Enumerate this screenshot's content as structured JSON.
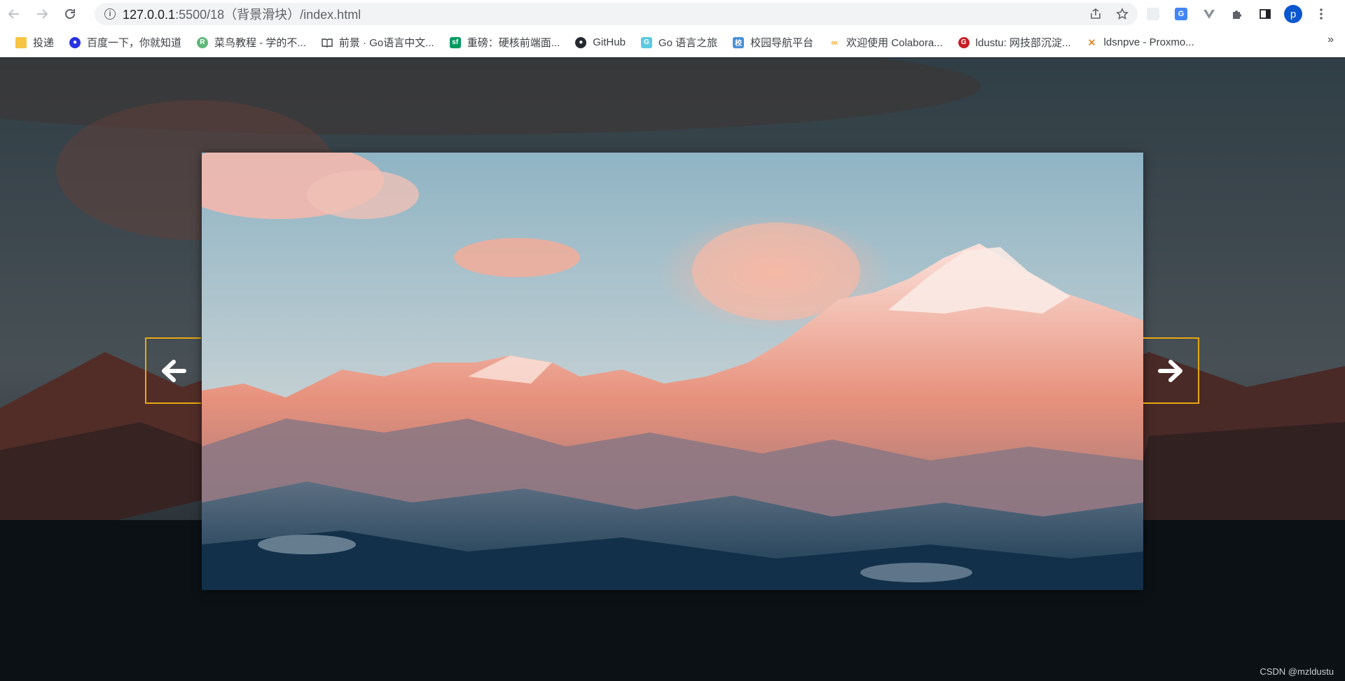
{
  "browser": {
    "url_host": "127.0.0.1",
    "url_path": ":5500/18（背景滑块）/index.html",
    "profile_initial": "p",
    "bookmarks": [
      {
        "label": "投递",
        "icon": "folder-icon",
        "color": "#f6c544"
      },
      {
        "label": "百度一下，你就知道",
        "icon": "baidu-icon",
        "color": "#2932e1"
      },
      {
        "label": "菜鸟教程 - 学的不...",
        "icon": "runoob-icon",
        "color": "#5fb878"
      },
      {
        "label": "前景 · Go语言中文...",
        "icon": "book-icon",
        "color": "#5f6368"
      },
      {
        "label": "重磅：硬核前端面...",
        "icon": "sf-icon",
        "color": "#009a61"
      },
      {
        "label": "GitHub",
        "icon": "github-icon",
        "color": "#24292f"
      },
      {
        "label": "Go 语言之旅",
        "icon": "gopher-icon",
        "color": "#5dc9e2"
      },
      {
        "label": "校园导航平台",
        "icon": "campus-icon",
        "color": "#4a90d9"
      },
      {
        "label": "欢迎使用 Colabora...",
        "icon": "colab-icon",
        "color": "#f9a825"
      },
      {
        "label": "ldustu: 网技部沉淀...",
        "icon": "gitee-icon",
        "color": "#c71d23"
      },
      {
        "label": "ldsnpve - Proxmo...",
        "icon": "proxmox-icon",
        "color": "#e57000"
      }
    ],
    "bookmarks_overflow": "»"
  },
  "page": {
    "watermark": "CSDN @mzldustu",
    "accent_color": "#e6a712"
  }
}
